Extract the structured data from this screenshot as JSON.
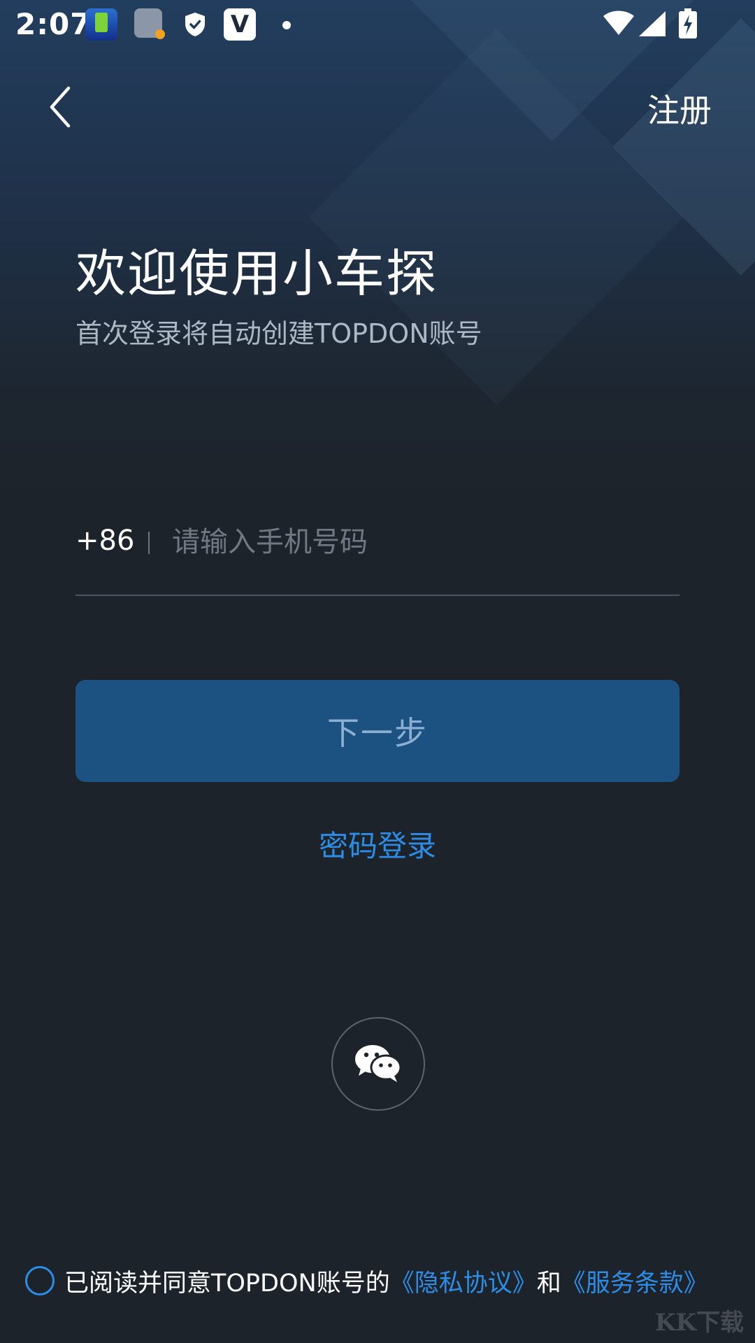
{
  "status_bar": {
    "time": "2:07",
    "icons": [
      "battery-app-icon",
      "battery-notification-icon",
      "shield-icon",
      "v-app-icon",
      "dot-icon",
      "wifi-icon",
      "signal-icon",
      "battery-charging-icon"
    ]
  },
  "header": {
    "back_icon": "chevron-left-icon",
    "register_label": "注册"
  },
  "welcome": {
    "title": "欢迎使用小车探",
    "subtitle": "首次登录将自动创建TOPDON账号"
  },
  "phone_field": {
    "country_code": "+86",
    "placeholder": "请输入手机号码",
    "value": ""
  },
  "next_button_label": "下一步",
  "password_login_label": "密码登录",
  "wechat_icon": "wechat-icon",
  "agreement": {
    "checked": false,
    "prefix": "已阅读并同意TOPDON账号的",
    "privacy_link": "《隐私协议》",
    "joiner": "和",
    "terms_link": "《服务条款》"
  },
  "watermark": "KK下载",
  "colors": {
    "background": "#1d232a",
    "primary_button": "#1b5282",
    "primary_button_text": "#8db0d2",
    "link": "#2d8de6"
  }
}
